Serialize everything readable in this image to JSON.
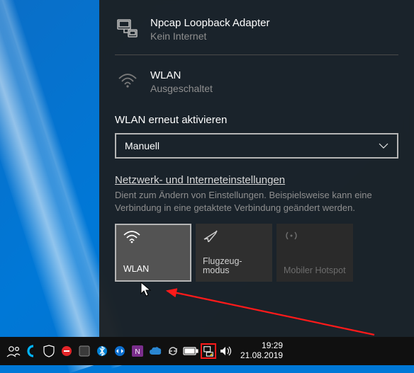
{
  "adapter": {
    "title": "Npcap Loopback Adapter",
    "status": "Kein Internet"
  },
  "wlan": {
    "title": "WLAN",
    "status": "Ausgeschaltet"
  },
  "reactivate_label": "WLAN erneut aktivieren",
  "dropdown": {
    "selected": "Manuell"
  },
  "settings_link": "Netzwerk- und Interneteinstellungen",
  "settings_desc": "Dient zum Ändern von Einstellungen. Beispielsweise kann eine Verbindung in eine getaktete Verbindung geändert werden.",
  "tiles": {
    "wlan": "WLAN",
    "airplane": "Flugzeug-\nmodus",
    "hotspot": "Mobiler Hotspot"
  },
  "clock": {
    "time": "19:29",
    "date": "21.08.2019"
  }
}
